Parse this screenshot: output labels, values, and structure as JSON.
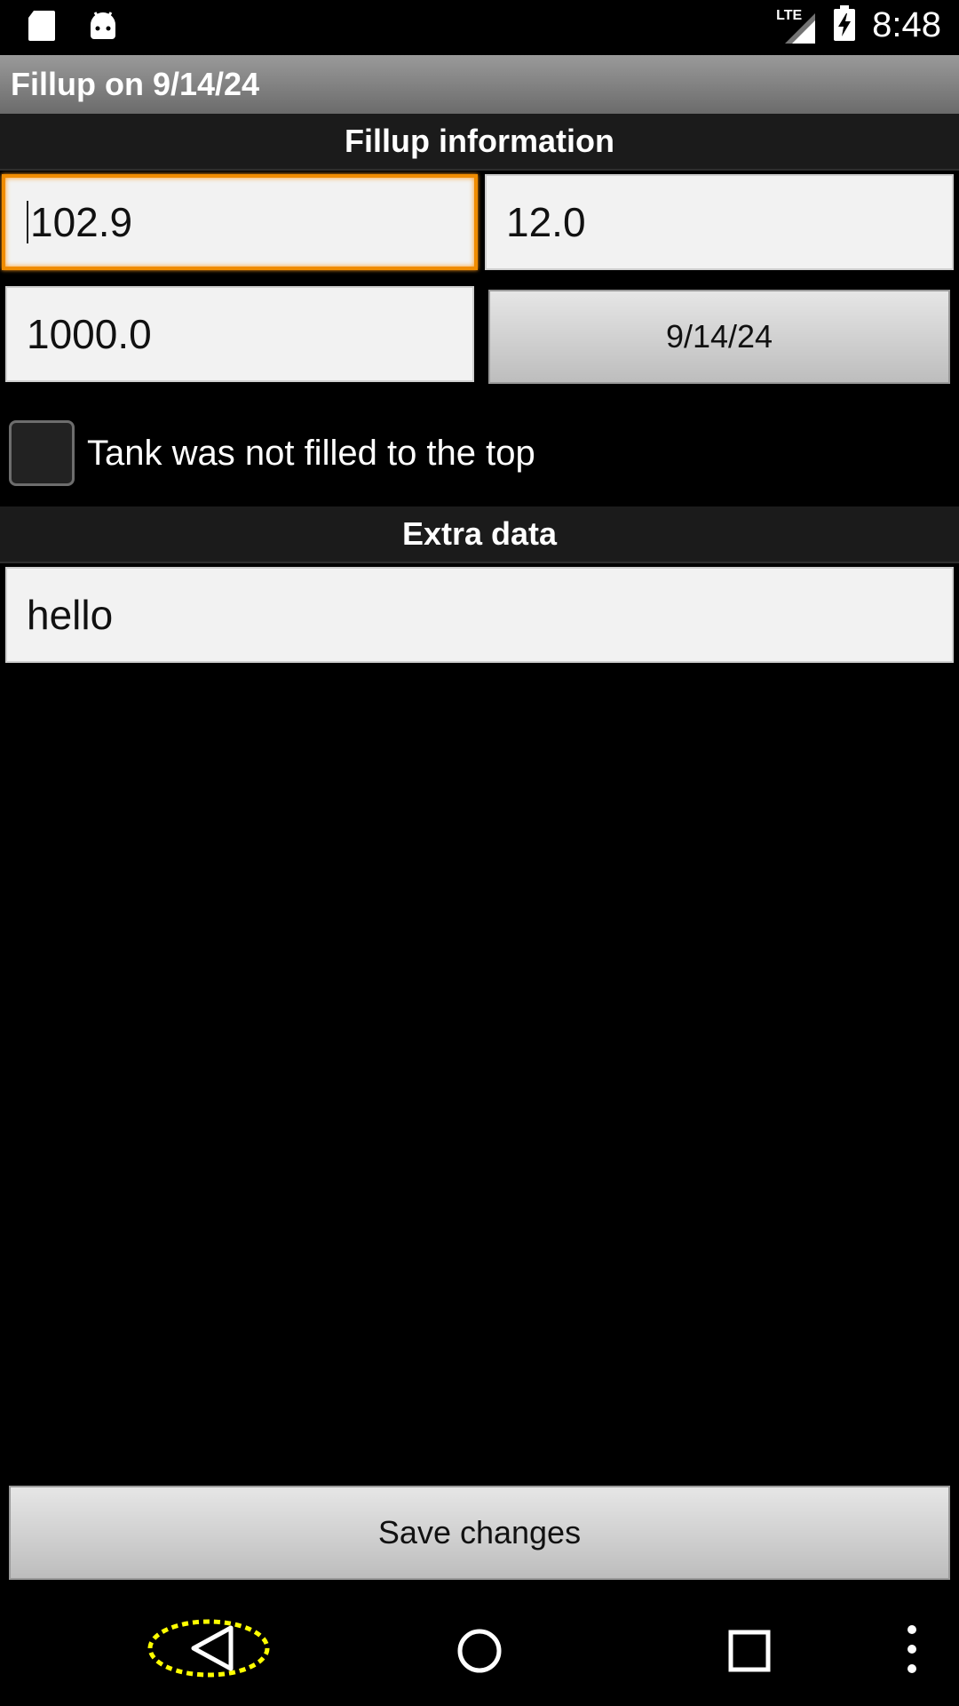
{
  "status_bar": {
    "time": "8:48",
    "network": "LTE",
    "icons": [
      "sd-card-icon",
      "android-icon",
      "signal-icon",
      "battery-charging-icon"
    ]
  },
  "app": {
    "title": "Fillup on 9/14/24"
  },
  "sections": {
    "fillup_info": "Fillup information",
    "extra_data": "Extra data"
  },
  "fields": {
    "field1_value": "102.9",
    "field2_value": "12.0",
    "field3_value": "1000.0",
    "extra_value": "hello"
  },
  "date_button": {
    "label": "9/14/24"
  },
  "checkbox": {
    "label": "Tank was not filled to the top",
    "checked": false
  },
  "save_button": {
    "label": "Save changes"
  },
  "nav": {
    "icons": [
      "back-icon",
      "home-icon",
      "recents-icon",
      "overflow-menu-icon"
    ]
  },
  "colors": {
    "focus_accent": "#f08c00",
    "highlight_ring": "#ffff00"
  }
}
